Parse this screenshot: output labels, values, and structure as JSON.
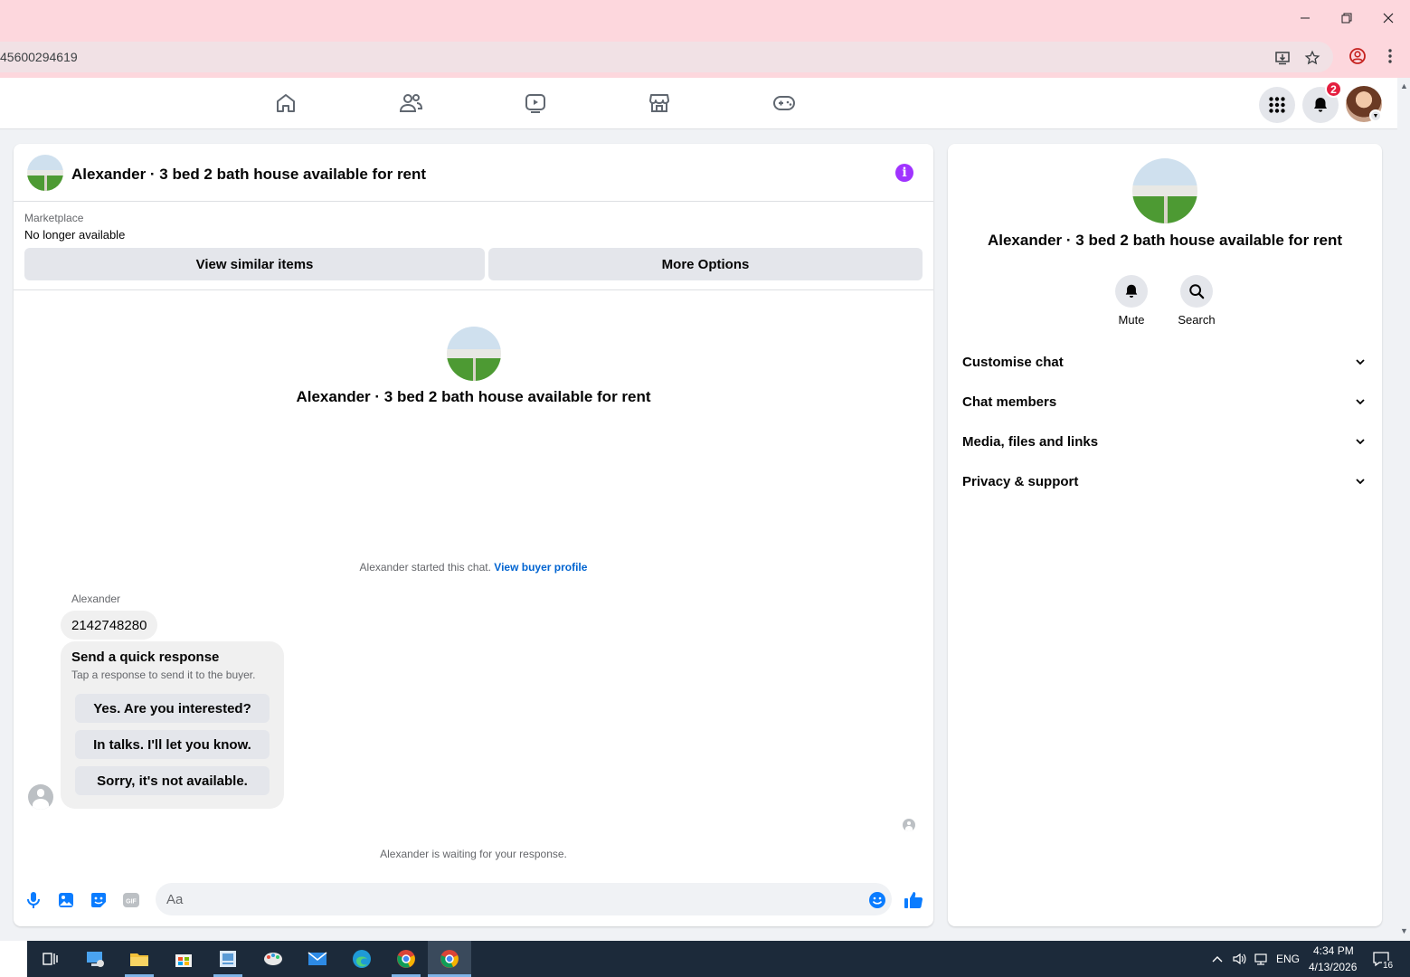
{
  "browser": {
    "url_fragment": "45600294619",
    "window_controls": {
      "minimize": "minimize-icon",
      "restore": "restore-icon",
      "close": "close-icon"
    }
  },
  "header": {
    "nav_icons": [
      "home-icon",
      "friends-icon",
      "watch-icon",
      "marketplace-icon",
      "gaming-icon"
    ],
    "notification_count": "2"
  },
  "chat": {
    "title": "Alexander · 3 bed 2 bath house available for rent",
    "marketplace_label": "Marketplace",
    "listing_status": "No longer available",
    "view_similar_label": "View similar items",
    "more_options_label": "More Options",
    "center_title": "Alexander · 3 bed 2 bath house available for rent",
    "started_text": "Alexander started this chat.",
    "buyer_profile_link": "View buyer profile",
    "sender_name": "Alexander",
    "message": "2142748280",
    "quick_response": {
      "title": "Send a quick response",
      "subtitle": "Tap a response to send it to the buyer.",
      "options": [
        "Yes. Are you interested?",
        "In talks. I'll let you know.",
        "Sorry, it's not available."
      ]
    },
    "waiting_text": "Alexander is waiting for your response.",
    "composer_placeholder": "Aa"
  },
  "side": {
    "title": "Alexander · 3 bed 2 bath house available for rent",
    "actions": [
      {
        "label": "Mute",
        "icon": "bell-icon"
      },
      {
        "label": "Search",
        "icon": "search-icon"
      }
    ],
    "sections": [
      "Customise chat",
      "Chat members",
      "Media, files and links",
      "Privacy & support"
    ]
  },
  "taskbar": {
    "language": "ENG",
    "time": "4:34 PM",
    "date": "4/13/2026",
    "notification_count": "16"
  },
  "colors": {
    "accent_purple": "#a033ff",
    "link_blue": "#0064d1",
    "messenger_blue": "#0a7cff",
    "badge_red": "#e41e3f"
  }
}
